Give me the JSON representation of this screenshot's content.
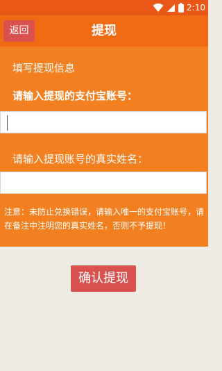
{
  "status_bar": {
    "time": "2:10",
    "wifi_icon": "wifi-icon",
    "signal_icon": "signal-icon",
    "battery_icon": "battery-icon"
  },
  "header": {
    "back_label": "返回",
    "title": "提现"
  },
  "form": {
    "section_title": "填写提现信息",
    "alipay_label": "请输入提现的支付宝账号：",
    "alipay_value": "",
    "name_label": "请输入提现账号的真实姓名：",
    "name_value": "",
    "notice": "注意：未防止兑换错误，请输入唯一的支付宝账号，请在备注中注明您的真实姓名，否则不予提现！"
  },
  "confirm_label": "确认提现",
  "colors": {
    "statusbar": "#e85718",
    "header": "#f06a14",
    "form": "#f27f20",
    "button": "#d9524f",
    "background": "#eeeae4"
  }
}
